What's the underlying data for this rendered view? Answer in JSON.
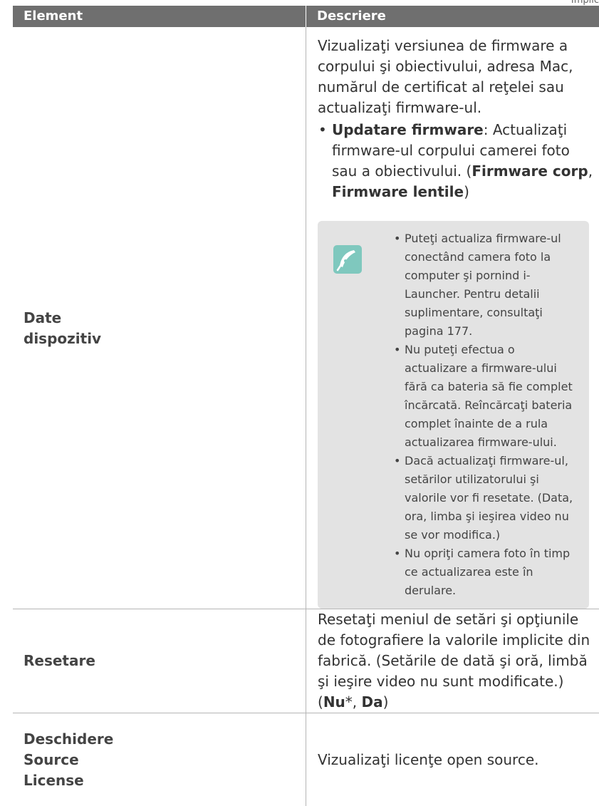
{
  "corner_label": "Implic",
  "headers": {
    "element": "Element",
    "description": "Descriere"
  },
  "device": {
    "element_lines": [
      "Date",
      "dispozitiv"
    ],
    "intro": "Vizualizaţi versiunea de firmware a corpului şi obiectivului, adresa Mac, numărul de certificat al reţelei sau actualizaţi firmware-ul.",
    "update": {
      "label": "Updatare firmware",
      "text": ": Actualizaţi firmware-ul corpului camerei foto sau a obiectivului. (",
      "opt1": "Firmware corp",
      "sep": ", ",
      "opt2": "Firmware lentile",
      "close": ")"
    },
    "note_icon": "pen-nib-icon",
    "notes": [
      "Puteţi actualiza firmware-ul conectând camera foto la computer şi pornind i-Launcher. Pentru detalii suplimentare, consultaţi pagina 177.",
      "Nu puteţi efectua o actualizare a firmware-ului fără ca bateria să fie complet încărcată. Reîncărcaţi bateria complet înainte de a rula actualizarea firmware-ului.",
      "Dacă actualizaţi firmware-ul, setărilor utilizatorului şi valorile vor fi resetate. (Data, ora, limba şi ieşirea video nu se vor modifica.)",
      "Nu opriţi camera foto în timp ce actualizarea este în derulare."
    ]
  },
  "reset": {
    "element": "Resetare",
    "text": "Resetaţi meniul de setări şi opţiunile de fotografiere la valorile implicite din fabrică. (Setările de dată şi oră, limbă şi ieşire video nu sunt modificate.) (",
    "opt1": "Nu",
    "star": "*",
    "sep": ", ",
    "opt2": "Da",
    "close": ")"
  },
  "oss": {
    "element_lines": [
      "Deschidere",
      "Source",
      "License"
    ],
    "text": "Vizualizaţi licenţe open source."
  },
  "colors": {
    "header_bg": "#6f6f6f",
    "note_bg": "#e3e3e3",
    "icon_bg": "#7fc8be"
  }
}
